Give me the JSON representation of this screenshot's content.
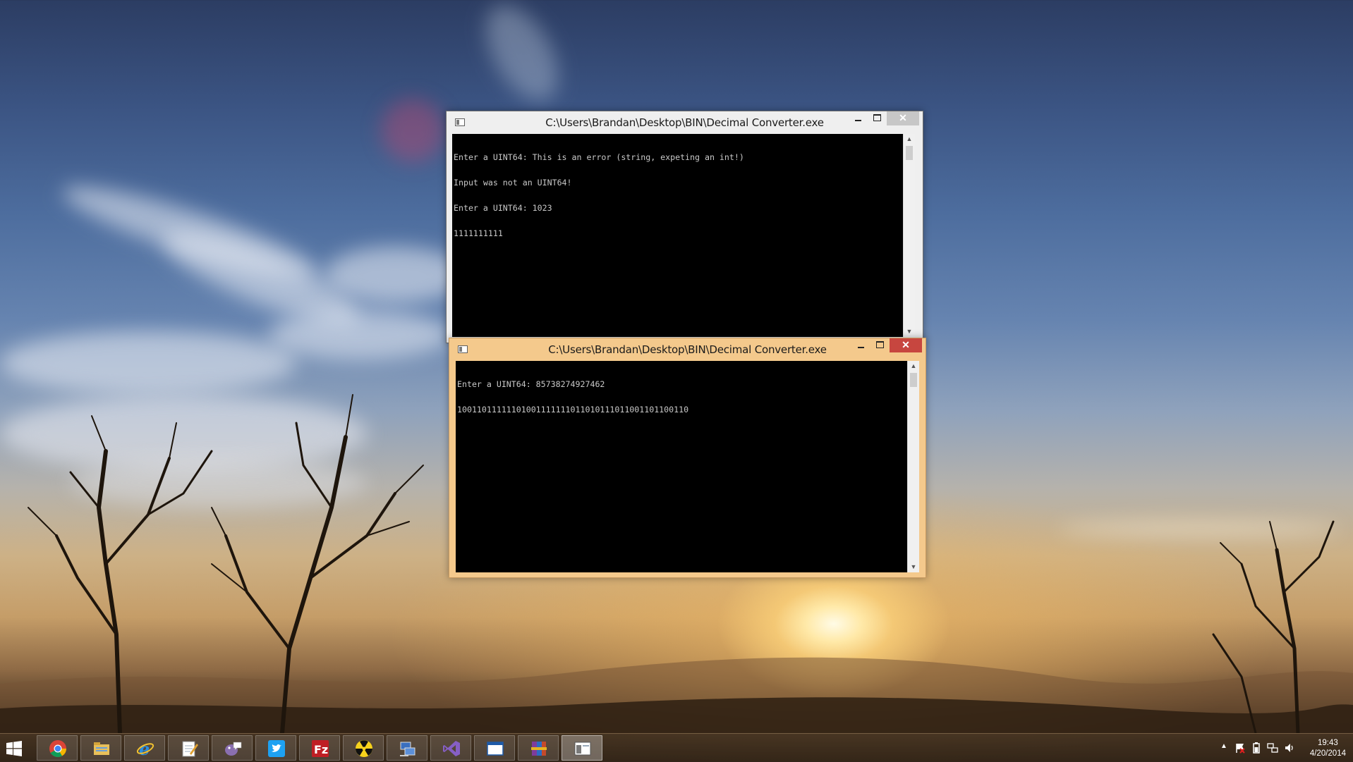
{
  "desktop": {
    "wallpaper": "sunset-sky-with-bare-trees"
  },
  "windows": [
    {
      "id": "console-1",
      "title": "C:\\Users\\Brandan\\Desktop\\BIN\\Decimal Converter.exe",
      "state": "inactive",
      "lines": [
        "Enter a UINT64: This is an error (string, expeting an int!)",
        "Input was not an UINT64!",
        "Enter a UINT64: 1023",
        "1111111111"
      ]
    },
    {
      "id": "console-2",
      "title": "C:\\Users\\Brandan\\Desktop\\BIN\\Decimal Converter.exe",
      "state": "active",
      "lines": [
        "Enter a UINT64: 85738274927462",
        "10011011111101001111111011010111011001101100110"
      ]
    }
  ],
  "window_controls": {
    "minimize": "minimize",
    "maximize": "maximize",
    "close": "✕"
  },
  "taskbar": {
    "start_icon": "windows-logo-icon",
    "items": [
      {
        "icon": "chrome-icon",
        "state": "pinned"
      },
      {
        "icon": "file-explorer-icon",
        "state": "pinned"
      },
      {
        "icon": "internet-explorer-icon",
        "state": "pinned"
      },
      {
        "icon": "notepad-icon",
        "state": "pinned"
      },
      {
        "icon": "pidgin-icon",
        "state": "pinned"
      },
      {
        "icon": "twitter-icon",
        "state": "pinned"
      },
      {
        "icon": "filezilla-icon",
        "state": "pinned"
      },
      {
        "icon": "radiation-app-icon",
        "state": "pinned"
      },
      {
        "icon": "network-computer-icon",
        "state": "pinned"
      },
      {
        "icon": "visual-studio-icon",
        "state": "pinned"
      },
      {
        "icon": "blank-window-icon",
        "state": "pinned"
      },
      {
        "icon": "winrar-icon",
        "state": "pinned"
      },
      {
        "icon": "console-app-icon",
        "state": "running"
      }
    ],
    "tray": {
      "icons": [
        "show-hidden-icons-chevron",
        "flag-icon",
        "power-icon",
        "network-icon",
        "volume-icon"
      ],
      "time": "19:43",
      "date": "4/20/2014"
    }
  },
  "colors": {
    "active_frame": "#f4c98c",
    "inactive_frame": "#efefef",
    "close_active": "#c7463f",
    "console_bg": "#000000",
    "console_text": "#c8c8c8"
  }
}
